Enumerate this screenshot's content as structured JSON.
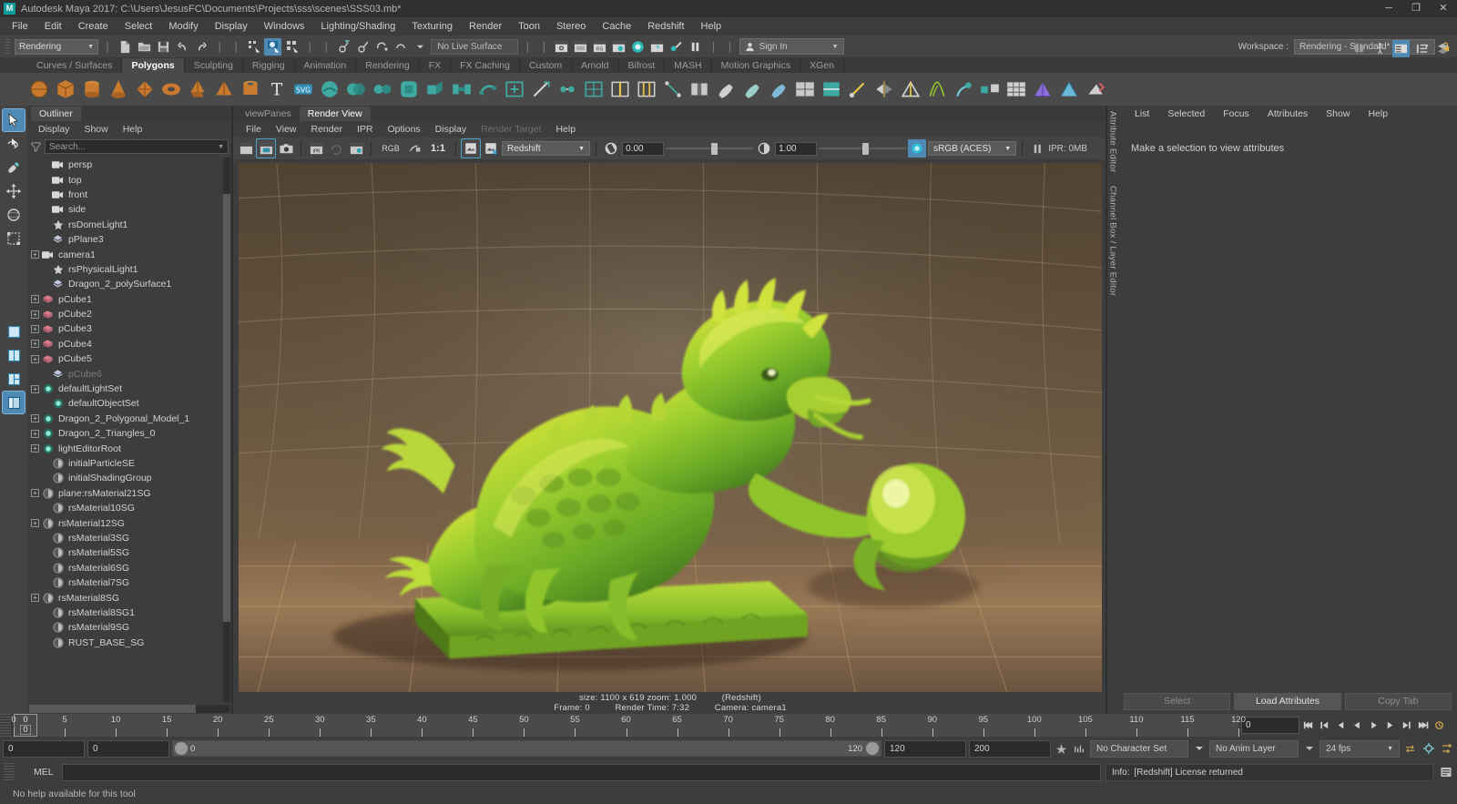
{
  "window": {
    "title": "Autodesk Maya 2017: C:\\Users\\JesusFC\\Documents\\Projects\\sss\\scenes\\SSS03.mb*",
    "logo": "M",
    "minimize": "─",
    "maximize": "❐",
    "close": "✕"
  },
  "menubar": {
    "items": [
      "File",
      "Edit",
      "Create",
      "Select",
      "Modify",
      "Display",
      "Windows",
      "Lighting/Shading",
      "Texturing",
      "Render",
      "Toon",
      "Stereo",
      "Cache",
      "Redshift",
      "Help"
    ]
  },
  "statusbar": {
    "mode_menu": "Rendering",
    "no_live_surface": "No Live Surface",
    "sign_in": "Sign In",
    "workspace_label": "Workspace :",
    "workspace_value": "Rendering - Standard*"
  },
  "shelf": {
    "tabs": [
      "Curves / Surfaces",
      "Polygons",
      "Sculpting",
      "Rigging",
      "Animation",
      "Rendering",
      "FX",
      "FX Caching",
      "Custom",
      "Arnold",
      "Bifrost",
      "MASH",
      "Motion Graphics",
      "XGen"
    ],
    "active_tab": "Polygons"
  },
  "outliner": {
    "tab": "Outliner",
    "menus": [
      "Display",
      "Show",
      "Help"
    ],
    "search_placeholder": "Search...",
    "items": [
      {
        "label": "persp",
        "icon": "camera-icon",
        "indent": 1,
        "expand": false,
        "dim": false
      },
      {
        "label": "top",
        "icon": "camera-icon",
        "indent": 1,
        "expand": false,
        "dim": false
      },
      {
        "label": "front",
        "icon": "camera-icon",
        "indent": 1,
        "expand": false,
        "dim": false
      },
      {
        "label": "side",
        "icon": "camera-icon",
        "indent": 1,
        "expand": false,
        "dim": false
      },
      {
        "label": "rsDomeLight1",
        "icon": "light-icon",
        "indent": 1,
        "expand": false,
        "dim": false
      },
      {
        "label": "pPlane3",
        "icon": "mesh-icon",
        "indent": 1,
        "expand": false,
        "dim": false
      },
      {
        "label": "camera1",
        "icon": "camera-icon",
        "indent": 0,
        "expand": true,
        "dim": false
      },
      {
        "label": "rsPhysicalLight1",
        "icon": "light-icon",
        "indent": 1,
        "expand": false,
        "dim": false
      },
      {
        "label": "Dragon_2_polySurface1",
        "icon": "mesh-icon",
        "indent": 1,
        "expand": false,
        "dim": false
      },
      {
        "label": "pCube1",
        "icon": "cube-icon",
        "indent": 0,
        "expand": true,
        "dim": false
      },
      {
        "label": "pCube2",
        "icon": "cube-icon",
        "indent": 0,
        "expand": true,
        "dim": false
      },
      {
        "label": "pCube3",
        "icon": "cube-icon",
        "indent": 0,
        "expand": true,
        "dim": false
      },
      {
        "label": "pCube4",
        "icon": "cube-icon",
        "indent": 0,
        "expand": true,
        "dim": false
      },
      {
        "label": "pCube5",
        "icon": "cube-icon",
        "indent": 0,
        "expand": true,
        "dim": false
      },
      {
        "label": "pCube6",
        "icon": "mesh-icon",
        "indent": 1,
        "expand": false,
        "dim": true
      },
      {
        "label": "defaultLightSet",
        "icon": "set-icon",
        "indent": 0,
        "expand": true,
        "dim": false
      },
      {
        "label": "defaultObjectSet",
        "icon": "set-icon",
        "indent": 1,
        "expand": false,
        "dim": false
      },
      {
        "label": "Dragon_2_Polygonal_Model_1",
        "icon": "set-icon",
        "indent": 0,
        "expand": true,
        "dim": false
      },
      {
        "label": "Dragon_2_Triangles_0",
        "icon": "set-icon",
        "indent": 0,
        "expand": true,
        "dim": false
      },
      {
        "label": "lightEditorRoot",
        "icon": "set-icon",
        "indent": 0,
        "expand": true,
        "dim": false
      },
      {
        "label": "initialParticleSE",
        "icon": "shading-group-icon",
        "indent": 1,
        "expand": false,
        "dim": false
      },
      {
        "label": "initialShadingGroup",
        "icon": "shading-group-icon",
        "indent": 1,
        "expand": false,
        "dim": false
      },
      {
        "label": "plane:rsMaterial21SG",
        "icon": "shading-group-icon",
        "indent": 0,
        "expand": true,
        "dim": false
      },
      {
        "label": "rsMaterial10SG",
        "icon": "shading-group-icon",
        "indent": 1,
        "expand": false,
        "dim": false
      },
      {
        "label": "rsMaterial12SG",
        "icon": "shading-group-icon",
        "indent": 0,
        "expand": true,
        "dim": false
      },
      {
        "label": "rsMaterial3SG",
        "icon": "shading-group-icon",
        "indent": 1,
        "expand": false,
        "dim": false
      },
      {
        "label": "rsMaterial5SG",
        "icon": "shading-group-icon",
        "indent": 1,
        "expand": false,
        "dim": false
      },
      {
        "label": "rsMaterial6SG",
        "icon": "shading-group-icon",
        "indent": 1,
        "expand": false,
        "dim": false
      },
      {
        "label": "rsMaterial7SG",
        "icon": "shading-group-icon",
        "indent": 1,
        "expand": false,
        "dim": false
      },
      {
        "label": "rsMaterial8SG",
        "icon": "shading-group-icon",
        "indent": 0,
        "expand": true,
        "dim": false
      },
      {
        "label": "rsMaterial8SG1",
        "icon": "shading-group-icon",
        "indent": 1,
        "expand": false,
        "dim": false
      },
      {
        "label": "rsMaterial9SG",
        "icon": "shading-group-icon",
        "indent": 1,
        "expand": false,
        "dim": false
      },
      {
        "label": "RUST_BASE_SG",
        "icon": "shading-group-icon",
        "indent": 1,
        "expand": false,
        "dim": false
      }
    ]
  },
  "render_view": {
    "tabs": [
      "viewPanes",
      "Render View"
    ],
    "active_tab": "Render View",
    "menus": [
      "File",
      "View",
      "Render",
      "IPR",
      "Options",
      "Display",
      "Render Target",
      "Help"
    ],
    "disabled_menu": "Render Target",
    "toolbar": {
      "rgb_label": "RGB",
      "ratio_label": "1:1",
      "renderer": "Redshift",
      "exposure_value": "0.00",
      "gamma_value": "1.00",
      "color_management": "sRGB (ACES)",
      "ipr_memory": "IPR: 0MB"
    },
    "status": {
      "size_line": "size: 1100 x 619 zoom: 1.000",
      "renderer_tag": "(Redshift)",
      "frame_label": "Frame:",
      "frame_value": "0",
      "render_time_label": "Render Time:",
      "render_time_value": "7:32",
      "camera_label": "Camera:",
      "camera_value": "camera1"
    }
  },
  "right_dock": {
    "vertical_tabs": [
      "Attribute Editor",
      "Channel Box / Layer Editor"
    ],
    "menus": [
      "List",
      "Selected",
      "Focus",
      "Attributes",
      "Show",
      "Help"
    ],
    "empty_message": "Make a selection to view attributes",
    "buttons": [
      "Select",
      "Load Attributes",
      "Copy Tab"
    ],
    "enabled_button": "Load Attributes"
  },
  "timeline": {
    "current_frame": "0",
    "ticks": [
      0,
      5,
      10,
      15,
      20,
      25,
      30,
      35,
      40,
      45,
      50,
      55,
      60,
      65,
      70,
      75,
      80,
      85,
      90,
      95,
      100,
      105,
      110,
      115,
      120
    ],
    "playback_field": "0",
    "range_start": "0",
    "range_end": "0",
    "slider_min": "0",
    "slider_max": "120",
    "anim_start": "120",
    "anim_end": "200",
    "character_set": "No Character Set",
    "anim_layer": "No Anim Layer",
    "fps": "24 fps"
  },
  "command_line": {
    "label": "MEL",
    "input_value": "",
    "info_label": "Info:",
    "info_text": "[Redshift] License returned"
  },
  "help_line": {
    "text": "No help available for this tool"
  },
  "colors": {
    "accent_blue": "#4f8ab5",
    "teal": "#0e9e9e",
    "bg": "#3d3d3d",
    "panel": "#444444"
  }
}
